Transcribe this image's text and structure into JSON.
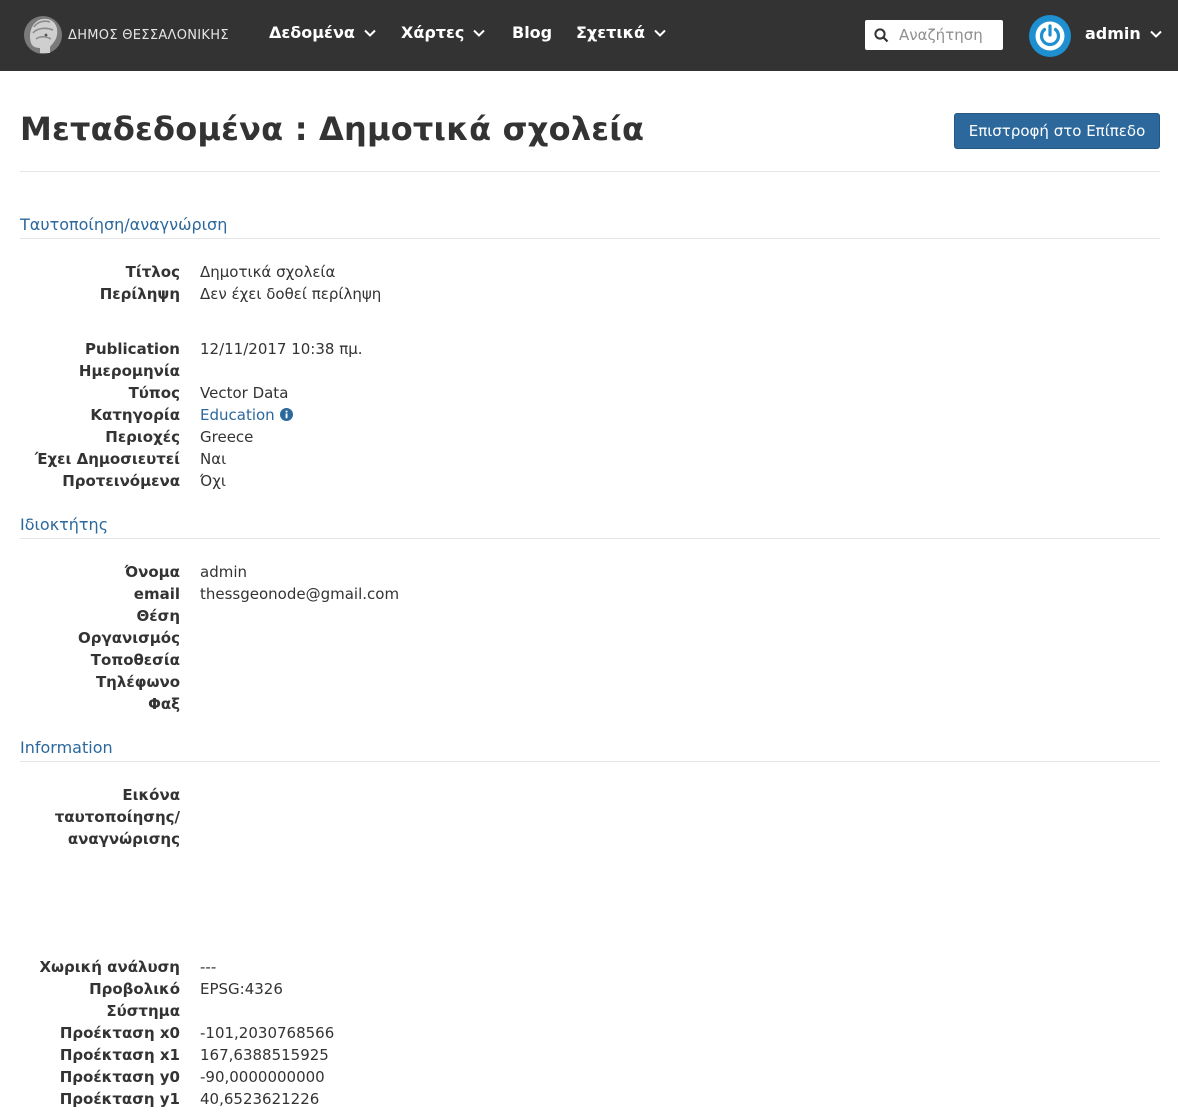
{
  "navbar": {
    "brand_text": "ΔΗΜΟΣ ΘΕΣΣΑΛΟΝΙΚΗΣ",
    "menu": [
      {
        "label": "Δεδομένα",
        "has_dropdown": true
      },
      {
        "label": "Χάρτες",
        "has_dropdown": true
      },
      {
        "label": "Blog",
        "has_dropdown": false
      },
      {
        "label": "Σχετικά",
        "has_dropdown": true
      }
    ],
    "search": {
      "placeholder": "Αναζήτηση",
      "value": ""
    },
    "user": {
      "name": "admin",
      "avatar_icon": "power-icon",
      "avatar_color": "#1e8fd0"
    },
    "background_color": "#333333"
  },
  "header": {
    "title": "Μεταδεδομένα : Δημοτικά σχολεία",
    "back_button_label": "Επιστροφή στο Επίπεδο",
    "back_button_color": "#2c689c"
  },
  "sections": {
    "identification": {
      "title": "Ταυτοποίηση/αναγνώριση",
      "fields": [
        {
          "label": "Τίτλος",
          "value": "Δημοτικά σχολεία"
        },
        {
          "label": "Περίληψη",
          "value": "Δεν έχει δοθεί περίληψη"
        },
        {
          "label_line1": "Publication",
          "label_line2": "Ημερομηνία",
          "value": "12/11/2017 10:38 πμ."
        },
        {
          "label": "Τύπος",
          "value": "Vector Data"
        },
        {
          "label": "Κατηγορία",
          "value": "Education",
          "icon": "info-circle-icon"
        },
        {
          "label": "Περιοχές",
          "value": "Greece"
        },
        {
          "label": "Έχει Δημοσιευτεί",
          "value": "Ναι"
        },
        {
          "label": "Προτεινόμενα",
          "value": "Όχι"
        }
      ]
    },
    "owner": {
      "title": "Ιδιοκτήτης",
      "fields": [
        {
          "label": "Όνομα",
          "value": "admin"
        },
        {
          "label": "email",
          "value": "thessgeonode@gmail.com"
        },
        {
          "label": "Θέση",
          "value": ""
        },
        {
          "label": "Οργανισμός",
          "value": ""
        },
        {
          "label": "Τοποθεσία",
          "value": ""
        },
        {
          "label": "Τηλέφωνο",
          "value": ""
        },
        {
          "label": "Φαξ",
          "value": ""
        }
      ]
    },
    "information": {
      "title": "Information",
      "fields": [
        {
          "label_line1": "Εικόνα",
          "label_line2": "ταυτοποίησης/",
          "label_line3": "αναγνώρισης",
          "value": ""
        },
        {
          "label": "Χωρική ανάλυση",
          "value": "---"
        },
        {
          "label_line1": "Προβολικό",
          "label_line2": "Σύστημα",
          "value": "EPSG:4326"
        },
        {
          "label": "Προέκταση x0",
          "value": "-101,2030768566"
        },
        {
          "label": "Προέκταση x1",
          "value": "167,6388515925"
        },
        {
          "label": "Προέκταση y0",
          "value": "-90,0000000000"
        },
        {
          "label": "Προέκταση y1",
          "value": "40,6523621226"
        }
      ]
    }
  },
  "colors": {
    "link": "#2c689c",
    "text": "#333333",
    "rule": "#e6e6e6"
  }
}
